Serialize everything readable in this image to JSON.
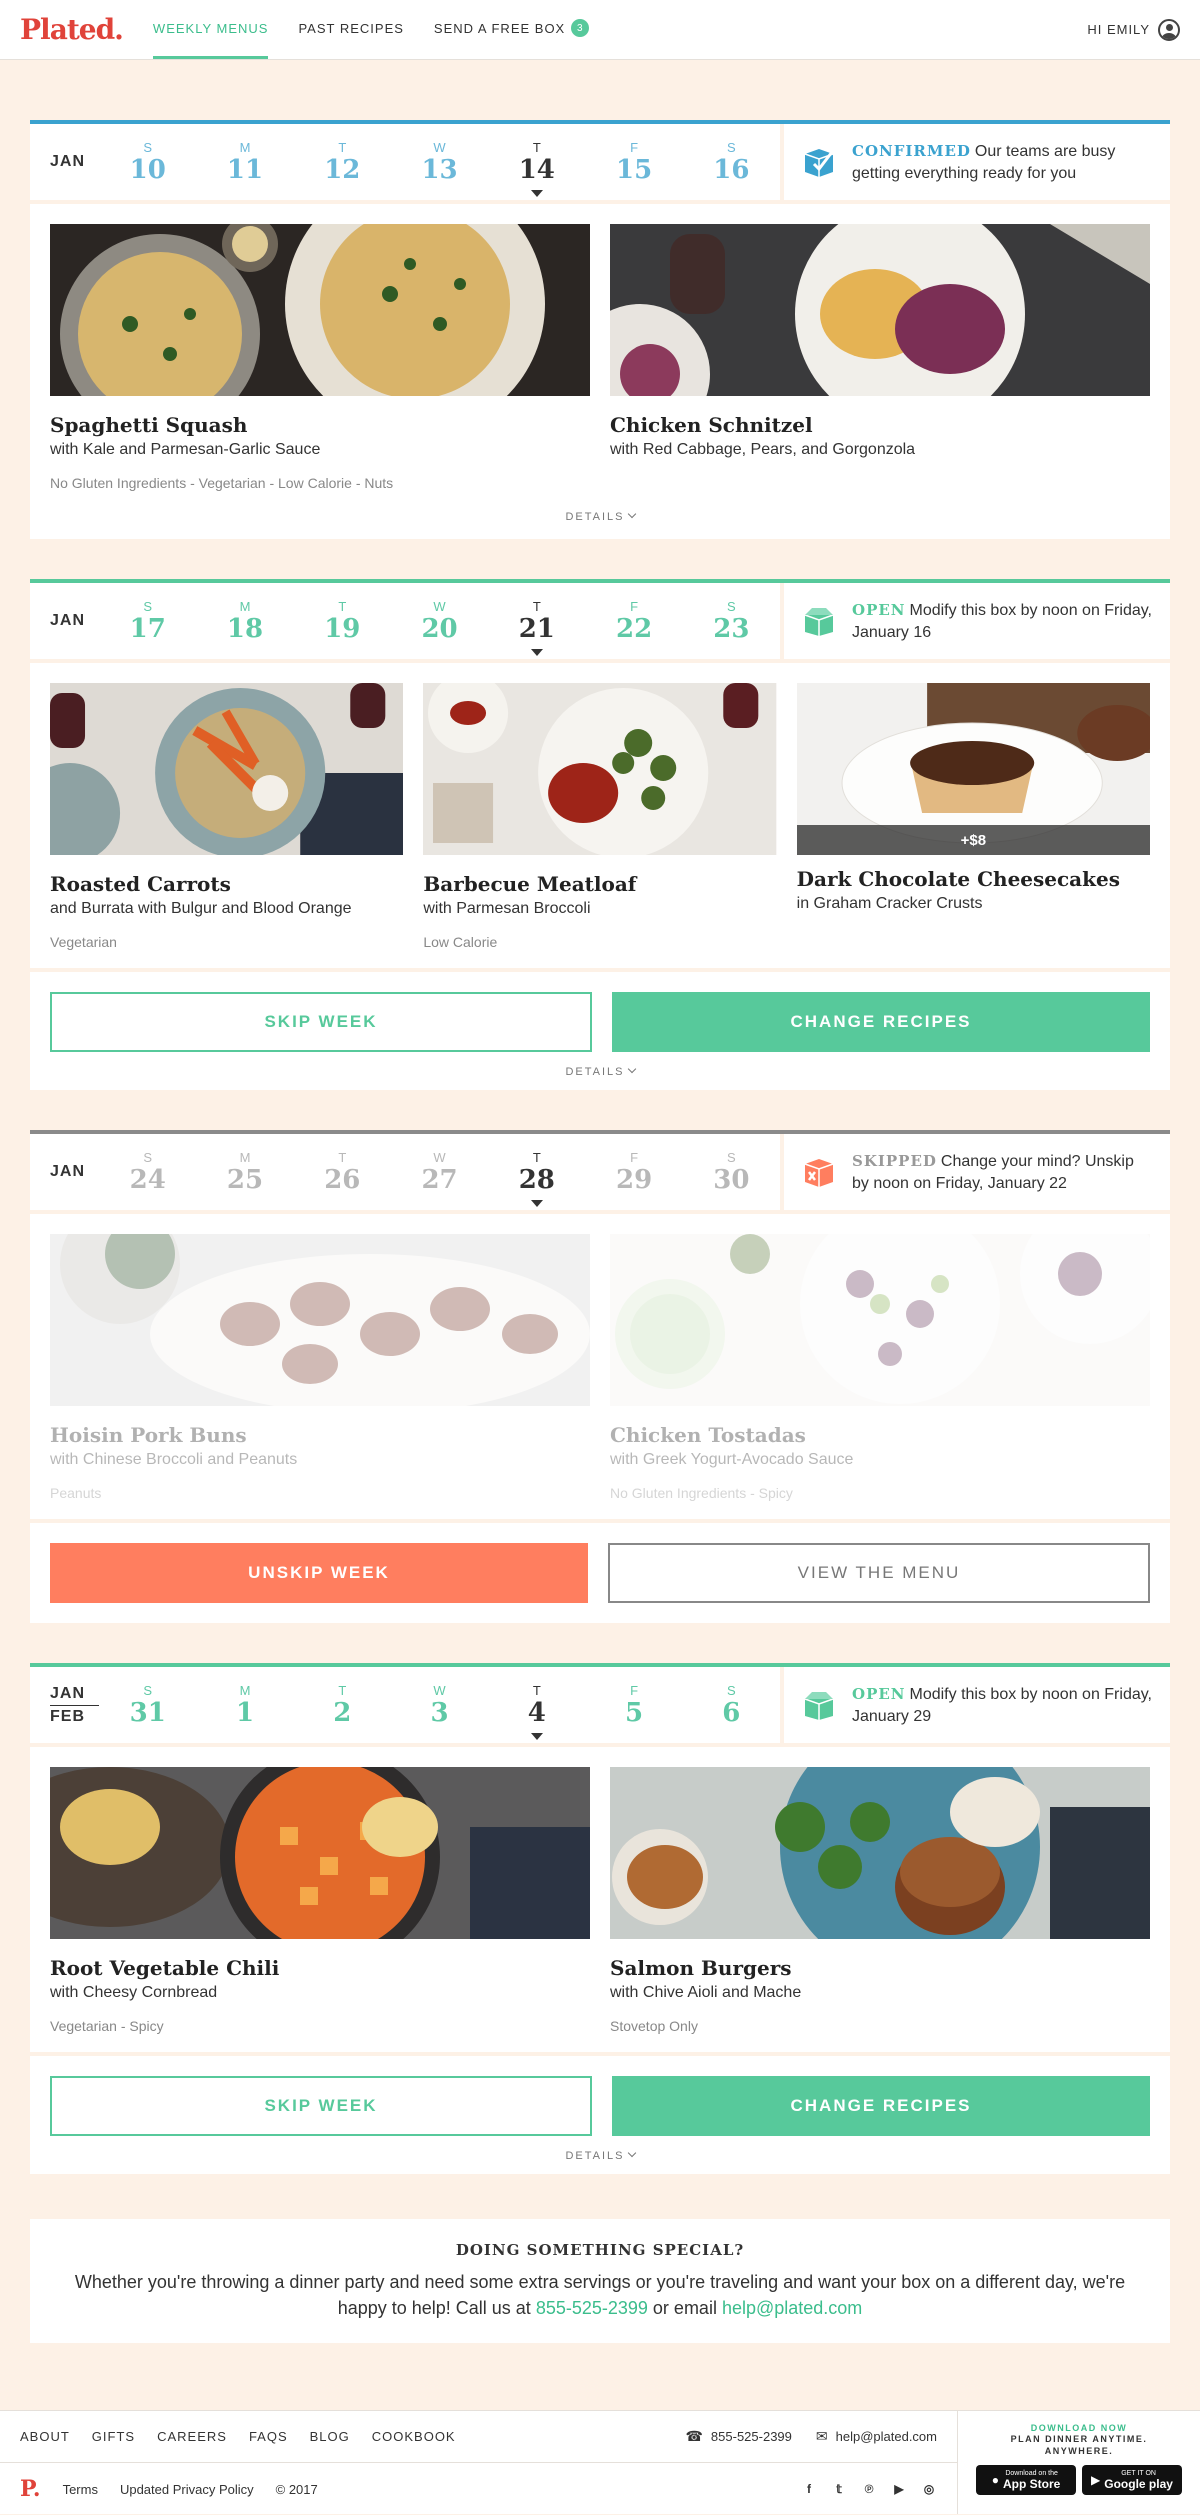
{
  "header": {
    "logo": "Plated.",
    "nav": [
      {
        "label": "WEEKLY MENUS",
        "active": true
      },
      {
        "label": "PAST RECIPES",
        "active": false
      },
      {
        "label": "SEND A FREE BOX",
        "active": false,
        "badge": "3"
      }
    ],
    "greeting": "HI EMILY"
  },
  "weeks": [
    {
      "status": "confirmed",
      "month": "JAN",
      "days": [
        {
          "dow": "S",
          "num": "10"
        },
        {
          "dow": "M",
          "num": "11"
        },
        {
          "dow": "T",
          "num": "12"
        },
        {
          "dow": "W",
          "num": "13"
        },
        {
          "dow": "T",
          "num": "14",
          "current": true
        },
        {
          "dow": "F",
          "num": "15"
        },
        {
          "dow": "S",
          "num": "16"
        }
      ],
      "status_word": "CONFIRMED",
      "status_text": "Our teams are busy getting everything ready for you",
      "recipes": [
        {
          "title": "Spaghetti Squash",
          "subtitle": "with Kale and Parmesan-Garlic Sauce",
          "tags": "No Gluten Ingredients  -  Vegetarian  -  Low Calorie  -  Nuts"
        },
        {
          "title": "Chicken Schnitzel",
          "subtitle": "with Red Cabbage, Pears, and Gorgonzola",
          "tags": ""
        }
      ],
      "details": "DETAILS"
    },
    {
      "status": "open",
      "month": "JAN",
      "days": [
        {
          "dow": "S",
          "num": "17"
        },
        {
          "dow": "M",
          "num": "18"
        },
        {
          "dow": "T",
          "num": "19"
        },
        {
          "dow": "W",
          "num": "20"
        },
        {
          "dow": "T",
          "num": "21",
          "current": true
        },
        {
          "dow": "F",
          "num": "22"
        },
        {
          "dow": "S",
          "num": "23"
        }
      ],
      "status_word": "OPEN",
      "status_text": "Modify this box by noon on Friday, January 16",
      "recipes": [
        {
          "title": "Roasted Carrots",
          "subtitle": "and Burrata with Bulgur and Blood Orange",
          "tags": "Vegetarian"
        },
        {
          "title": "Barbecue Meatloaf",
          "subtitle": "with Parmesan Broccoli",
          "tags": "Low Calorie"
        },
        {
          "title": "Dark Chocolate Cheesecakes",
          "subtitle": "in Graham Cracker Crusts",
          "tags": "",
          "extra": "+$8"
        }
      ],
      "buttons": {
        "left": "SKIP WEEK",
        "right": "CHANGE RECIPES"
      },
      "details": "DETAILS"
    },
    {
      "status": "skipped",
      "month": "JAN",
      "days": [
        {
          "dow": "S",
          "num": "24"
        },
        {
          "dow": "M",
          "num": "25"
        },
        {
          "dow": "T",
          "num": "26"
        },
        {
          "dow": "W",
          "num": "27"
        },
        {
          "dow": "T",
          "num": "28",
          "current": true
        },
        {
          "dow": "F",
          "num": "29"
        },
        {
          "dow": "S",
          "num": "30"
        }
      ],
      "status_word": "SKIPPED",
      "status_text": "Change your mind? Unskip by noon on Friday, January 22",
      "recipes": [
        {
          "title": "Hoisin Pork Buns",
          "subtitle": "with Chinese Broccoli and Peanuts",
          "tags": "Peanuts"
        },
        {
          "title": "Chicken Tostadas",
          "subtitle": "with Greek Yogurt-Avocado Sauce",
          "tags": "No Gluten Ingredients  -  Spicy"
        }
      ],
      "buttons": {
        "left": "UNSKIP WEEK",
        "right": "VIEW THE MENU"
      }
    },
    {
      "status": "open",
      "month": "JAN",
      "month2": "FEB",
      "days": [
        {
          "dow": "S",
          "num": "31"
        },
        {
          "dow": "M",
          "num": "1"
        },
        {
          "dow": "T",
          "num": "2"
        },
        {
          "dow": "W",
          "num": "3"
        },
        {
          "dow": "T",
          "num": "4",
          "current": true
        },
        {
          "dow": "F",
          "num": "5"
        },
        {
          "dow": "S",
          "num": "6"
        }
      ],
      "status_word": "OPEN",
      "status_text": "Modify this box by noon on Friday, January 29",
      "recipes": [
        {
          "title": "Root Vegetable Chili",
          "subtitle": "with Cheesy Cornbread",
          "tags": "Vegetarian  -  Spicy"
        },
        {
          "title": "Salmon Burgers",
          "subtitle": "with Chive Aioli and Mache",
          "tags": "Stovetop Only"
        }
      ],
      "buttons": {
        "left": "SKIP WEEK",
        "right": "CHANGE RECIPES"
      },
      "details": "DETAILS"
    }
  ],
  "special": {
    "title": "DOING SOMETHING SPECIAL?",
    "text1": "Whether you're throwing a dinner party and need some extra servings or you're traveling and want your box on a different day, we're happy to help! Call us at ",
    "phone": "855-525-2399",
    "text2": " or email ",
    "email": "help@plated.com"
  },
  "footer": {
    "links": [
      "ABOUT",
      "GIFTS",
      "CAREERS",
      "FAQS",
      "BLOG",
      "COOKBOOK"
    ],
    "phone": "855-525-2399",
    "email": "help@plated.com",
    "logo": "P.",
    "terms": "Terms",
    "privacy": "Updated Privacy Policy",
    "copyright": "© 2017",
    "download_now": "DOWNLOAD NOW",
    "plan_dinner": "PLAN DINNER ANYTIME.",
    "anywhere": "ANYWHERE.",
    "app_store_small": "Download on the",
    "app_store": "App Store",
    "google_small": "GET IT ON",
    "google": "Google play"
  },
  "colors": {
    "brand": "#e0433a",
    "accent": "#57c99b",
    "confirmed": "#3aa2cf",
    "skip": "#ff7e5f"
  }
}
